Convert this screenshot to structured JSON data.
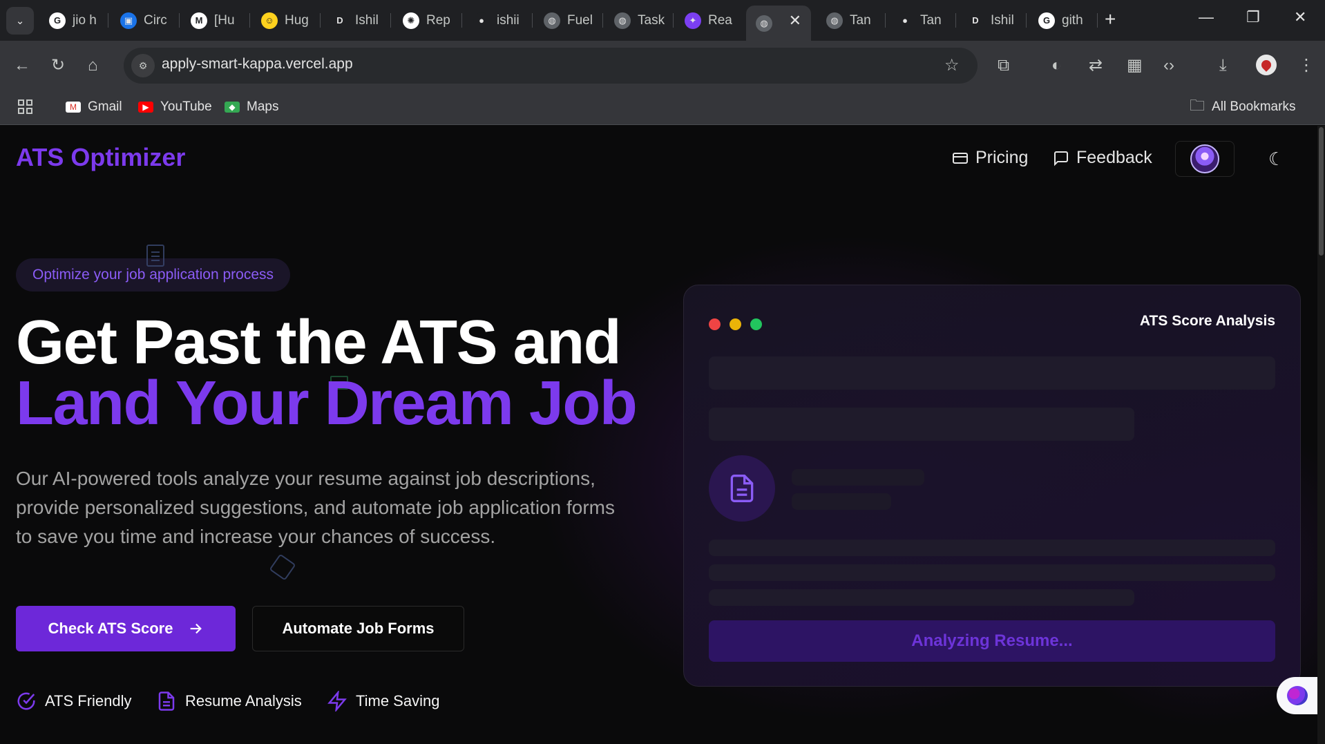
{
  "browser": {
    "tabs": [
      {
        "label": "jio h",
        "icon": "google-icon",
        "color": "#ffffff"
      },
      {
        "label": "Circ",
        "icon": "contact-icon",
        "color": "#1a73e8"
      },
      {
        "label": "[Hu",
        "icon": "gmail-icon",
        "color": "#ffffff"
      },
      {
        "label": "Hug",
        "icon": "huggingface-icon",
        "color": "#ffd21e"
      },
      {
        "label": "Ishil",
        "icon": "d-icon",
        "color": "#1f2023"
      },
      {
        "label": "Rep",
        "icon": "openai-icon",
        "color": "#ffffff"
      },
      {
        "label": "ishii",
        "icon": "github-icon",
        "color": "#1f2023"
      },
      {
        "label": "Fuel",
        "icon": "globe-icon",
        "color": "#5f6368"
      },
      {
        "label": "Task",
        "icon": "globe-icon",
        "color": "#5f6368"
      },
      {
        "label": "Rea",
        "icon": "react-icon",
        "color": "#7b3ff2"
      },
      {
        "label": "",
        "icon": "globe-icon",
        "color": "#5f6368"
      },
      {
        "label": "Tan",
        "icon": "globe-icon",
        "color": "#5f6368"
      },
      {
        "label": "Tan",
        "icon": "github-icon",
        "color": "#1f2023"
      },
      {
        "label": "Ishil",
        "icon": "d-icon",
        "color": "#1f2023"
      },
      {
        "label": "gith",
        "icon": "google-icon",
        "color": "#ffffff"
      }
    ],
    "url": "apply-smart-kappa.vercel.app",
    "bookmarks": [
      {
        "label": "Gmail",
        "icon": "gmail-icon"
      },
      {
        "label": "YouTube",
        "icon": "youtube-icon"
      },
      {
        "label": "Maps",
        "icon": "maps-icon"
      }
    ],
    "all_bookmarks": "All Bookmarks"
  },
  "nav": {
    "brand": "ATS Optimizer",
    "pricing": "Pricing",
    "feedback": "Feedback"
  },
  "hero": {
    "pill": "Optimize your job application process",
    "title_line1": "Get Past the ATS and",
    "title_line2": "Land Your Dream Job",
    "lead": "Our AI-powered tools analyze your resume against job descriptions, provide personalized suggestions, and automate job application forms to save you time and increase your chances of success.",
    "primary_cta": "Check ATS Score",
    "secondary_cta": "Automate Job Forms",
    "features": [
      "ATS Friendly",
      "Resume Analysis",
      "Time Saving"
    ]
  },
  "card": {
    "title": "ATS Score Analysis",
    "button": "Analyzing Resume..."
  },
  "colors": {
    "accent": "#7c3aed",
    "accent_dark": "#6d28d9",
    "dot_red": "#ef4444",
    "dot_yellow": "#eab308",
    "dot_green": "#22c55e"
  }
}
